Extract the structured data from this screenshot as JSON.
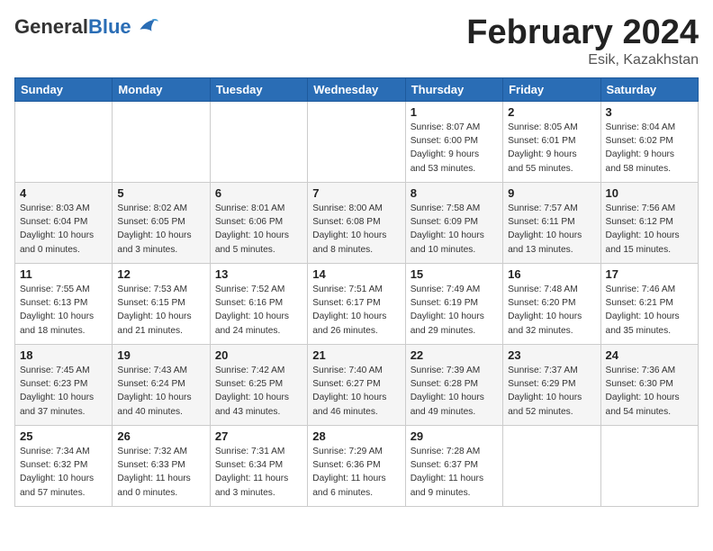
{
  "header": {
    "logo_general": "General",
    "logo_blue": "Blue",
    "month_title": "February 2024",
    "location": "Esik, Kazakhstan"
  },
  "days_of_week": [
    "Sunday",
    "Monday",
    "Tuesday",
    "Wednesday",
    "Thursday",
    "Friday",
    "Saturday"
  ],
  "weeks": [
    [
      {
        "day": "",
        "info": ""
      },
      {
        "day": "",
        "info": ""
      },
      {
        "day": "",
        "info": ""
      },
      {
        "day": "",
        "info": ""
      },
      {
        "day": "1",
        "info": "Sunrise: 8:07 AM\nSunset: 6:00 PM\nDaylight: 9 hours\nand 53 minutes."
      },
      {
        "day": "2",
        "info": "Sunrise: 8:05 AM\nSunset: 6:01 PM\nDaylight: 9 hours\nand 55 minutes."
      },
      {
        "day": "3",
        "info": "Sunrise: 8:04 AM\nSunset: 6:02 PM\nDaylight: 9 hours\nand 58 minutes."
      }
    ],
    [
      {
        "day": "4",
        "info": "Sunrise: 8:03 AM\nSunset: 6:04 PM\nDaylight: 10 hours\nand 0 minutes."
      },
      {
        "day": "5",
        "info": "Sunrise: 8:02 AM\nSunset: 6:05 PM\nDaylight: 10 hours\nand 3 minutes."
      },
      {
        "day": "6",
        "info": "Sunrise: 8:01 AM\nSunset: 6:06 PM\nDaylight: 10 hours\nand 5 minutes."
      },
      {
        "day": "7",
        "info": "Sunrise: 8:00 AM\nSunset: 6:08 PM\nDaylight: 10 hours\nand 8 minutes."
      },
      {
        "day": "8",
        "info": "Sunrise: 7:58 AM\nSunset: 6:09 PM\nDaylight: 10 hours\nand 10 minutes."
      },
      {
        "day": "9",
        "info": "Sunrise: 7:57 AM\nSunset: 6:11 PM\nDaylight: 10 hours\nand 13 minutes."
      },
      {
        "day": "10",
        "info": "Sunrise: 7:56 AM\nSunset: 6:12 PM\nDaylight: 10 hours\nand 15 minutes."
      }
    ],
    [
      {
        "day": "11",
        "info": "Sunrise: 7:55 AM\nSunset: 6:13 PM\nDaylight: 10 hours\nand 18 minutes."
      },
      {
        "day": "12",
        "info": "Sunrise: 7:53 AM\nSunset: 6:15 PM\nDaylight: 10 hours\nand 21 minutes."
      },
      {
        "day": "13",
        "info": "Sunrise: 7:52 AM\nSunset: 6:16 PM\nDaylight: 10 hours\nand 24 minutes."
      },
      {
        "day": "14",
        "info": "Sunrise: 7:51 AM\nSunset: 6:17 PM\nDaylight: 10 hours\nand 26 minutes."
      },
      {
        "day": "15",
        "info": "Sunrise: 7:49 AM\nSunset: 6:19 PM\nDaylight: 10 hours\nand 29 minutes."
      },
      {
        "day": "16",
        "info": "Sunrise: 7:48 AM\nSunset: 6:20 PM\nDaylight: 10 hours\nand 32 minutes."
      },
      {
        "day": "17",
        "info": "Sunrise: 7:46 AM\nSunset: 6:21 PM\nDaylight: 10 hours\nand 35 minutes."
      }
    ],
    [
      {
        "day": "18",
        "info": "Sunrise: 7:45 AM\nSunset: 6:23 PM\nDaylight: 10 hours\nand 37 minutes."
      },
      {
        "day": "19",
        "info": "Sunrise: 7:43 AM\nSunset: 6:24 PM\nDaylight: 10 hours\nand 40 minutes."
      },
      {
        "day": "20",
        "info": "Sunrise: 7:42 AM\nSunset: 6:25 PM\nDaylight: 10 hours\nand 43 minutes."
      },
      {
        "day": "21",
        "info": "Sunrise: 7:40 AM\nSunset: 6:27 PM\nDaylight: 10 hours\nand 46 minutes."
      },
      {
        "day": "22",
        "info": "Sunrise: 7:39 AM\nSunset: 6:28 PM\nDaylight: 10 hours\nand 49 minutes."
      },
      {
        "day": "23",
        "info": "Sunrise: 7:37 AM\nSunset: 6:29 PM\nDaylight: 10 hours\nand 52 minutes."
      },
      {
        "day": "24",
        "info": "Sunrise: 7:36 AM\nSunset: 6:30 PM\nDaylight: 10 hours\nand 54 minutes."
      }
    ],
    [
      {
        "day": "25",
        "info": "Sunrise: 7:34 AM\nSunset: 6:32 PM\nDaylight: 10 hours\nand 57 minutes."
      },
      {
        "day": "26",
        "info": "Sunrise: 7:32 AM\nSunset: 6:33 PM\nDaylight: 11 hours\nand 0 minutes."
      },
      {
        "day": "27",
        "info": "Sunrise: 7:31 AM\nSunset: 6:34 PM\nDaylight: 11 hours\nand 3 minutes."
      },
      {
        "day": "28",
        "info": "Sunrise: 7:29 AM\nSunset: 6:36 PM\nDaylight: 11 hours\nand 6 minutes."
      },
      {
        "day": "29",
        "info": "Sunrise: 7:28 AM\nSunset: 6:37 PM\nDaylight: 11 hours\nand 9 minutes."
      },
      {
        "day": "",
        "info": ""
      },
      {
        "day": "",
        "info": ""
      }
    ]
  ]
}
